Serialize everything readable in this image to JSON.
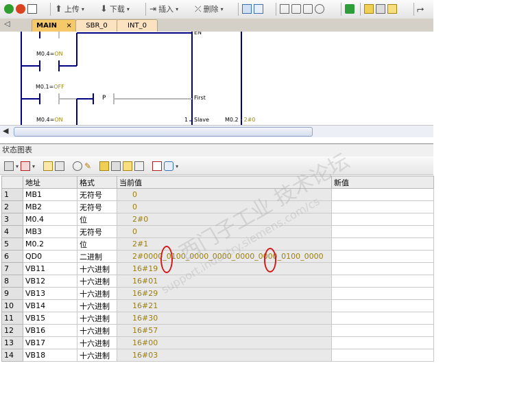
{
  "toolbar": {
    "upload_label": "上传",
    "download_label": "下载",
    "insert_label": "插入",
    "delete_label": "删除"
  },
  "tabs": [
    {
      "label": "MAIN",
      "close": "×"
    },
    {
      "label": "SBR_0"
    },
    {
      "label": "INT_0"
    }
  ],
  "ladder": {
    "en_label": "EN",
    "contact1": "M0.4",
    "contact1_state": "ON",
    "contact2": "M0.1",
    "contact2_state": "OFF",
    "p_label": "P",
    "first_label": "First",
    "contact3": "M0.4",
    "contact3_state": "ON",
    "slave_prefix": "1",
    "slave_label": "Slave",
    "out_addr": "M0.2",
    "out_value": "2#0",
    "eq": "="
  },
  "status_chart": {
    "title": "状态图表",
    "columns": {
      "num": "",
      "address": "地址",
      "format": "格式",
      "current": "当前值",
      "new": "新值"
    },
    "rows": [
      {
        "n": "1",
        "address": "MB1",
        "format": "无符号",
        "current": "0",
        "new": ""
      },
      {
        "n": "2",
        "address": "MB2",
        "format": "无符号",
        "current": "0",
        "new": ""
      },
      {
        "n": "3",
        "address": "M0.4",
        "format": "位",
        "current": "2#0",
        "new": ""
      },
      {
        "n": "4",
        "address": "MB3",
        "format": "无符号",
        "current": "0",
        "new": ""
      },
      {
        "n": "5",
        "address": "M0.2",
        "format": "位",
        "current": "2#1",
        "new": ""
      },
      {
        "n": "6",
        "address": "QD0",
        "format": "二进制",
        "current": "2#0000_0100_0000_0000_0000_0000_0100_0000",
        "new": ""
      },
      {
        "n": "7",
        "address": "VB11",
        "format": "十六进制",
        "current": "16#19",
        "new": ""
      },
      {
        "n": "8",
        "address": "VB12",
        "format": "十六进制",
        "current": "16#01",
        "new": ""
      },
      {
        "n": "9",
        "address": "VB13",
        "format": "十六进制",
        "current": "16#29",
        "new": ""
      },
      {
        "n": "10",
        "address": "VB14",
        "format": "十六进制",
        "current": "16#21",
        "new": ""
      },
      {
        "n": "11",
        "address": "VB15",
        "format": "十六进制",
        "current": "16#30",
        "new": ""
      },
      {
        "n": "12",
        "address": "VB16",
        "format": "十六进制",
        "current": "16#57",
        "new": ""
      },
      {
        "n": "13",
        "address": "VB17",
        "format": "十六进制",
        "current": "16#00",
        "new": ""
      },
      {
        "n": "14",
        "address": "VB18",
        "format": "十六进制",
        "current": "16#03",
        "new": ""
      }
    ]
  },
  "watermark": {
    "line1": "西门子工业 技术论坛",
    "line2": "support.industry.siemens.com/cs"
  },
  "colors": {
    "value_text": "#9a7e10",
    "tab_active": "#f5c96a",
    "tab_inactive": "#fbe2c0",
    "ring": "#d31818",
    "rail": "#000080"
  }
}
